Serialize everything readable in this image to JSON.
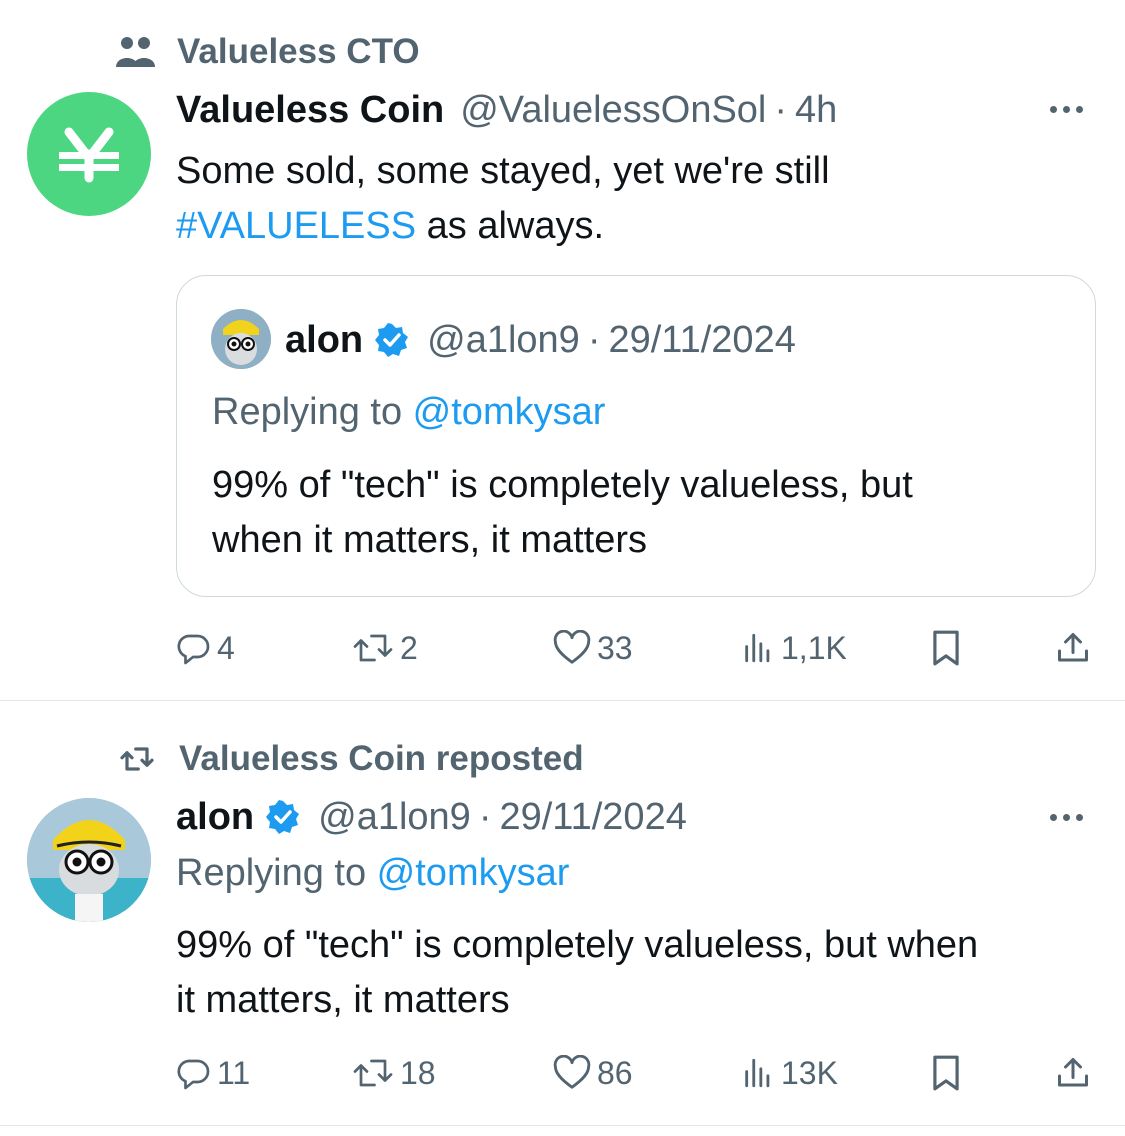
{
  "post1": {
    "context": "Valueless CTO",
    "author_name": "Valueless Coin",
    "handle": "@ValuelessOnSol",
    "time": "4h",
    "text_line1": "Some sold, some stayed, yet we're still",
    "hashtag": "#VALUELESS",
    "text_line2_rest": " as always.",
    "avatar_symbol": "₩",
    "avatar_color": "#4dd681",
    "quote": {
      "author_name": "alon",
      "handle": "@a1lon9",
      "date": "29/11/2024",
      "replying_prefix": "Replying to ",
      "replying_to": "@tomkysar",
      "text_line1": "99% of \"tech\" is completely valueless, but",
      "text_line2": "when it matters, it matters"
    },
    "stats": {
      "replies": "4",
      "reposts": "2",
      "likes": "33",
      "views": "1,1K"
    }
  },
  "post2": {
    "context": "Valueless Coin reposted",
    "author_name": "alon",
    "handle": "@a1lon9",
    "date": "29/11/2024",
    "replying_prefix": "Replying to ",
    "replying_to": "@tomkysar",
    "text_line1": "99% of \"tech\" is completely valueless, but when",
    "text_line2": "it matters, it matters",
    "stats": {
      "replies": "11",
      "reposts": "18",
      "likes": "86",
      "views": "13K"
    }
  },
  "colors": {
    "link": "#1d9bf0",
    "muted": "#536471",
    "verified": "#1d9bf0",
    "border": "#cfd9de"
  },
  "icons": [
    "community-icon",
    "more-icon",
    "reply-icon",
    "repost-icon",
    "like-icon",
    "views-icon",
    "bookmark-icon",
    "share-icon",
    "verified-icon"
  ]
}
